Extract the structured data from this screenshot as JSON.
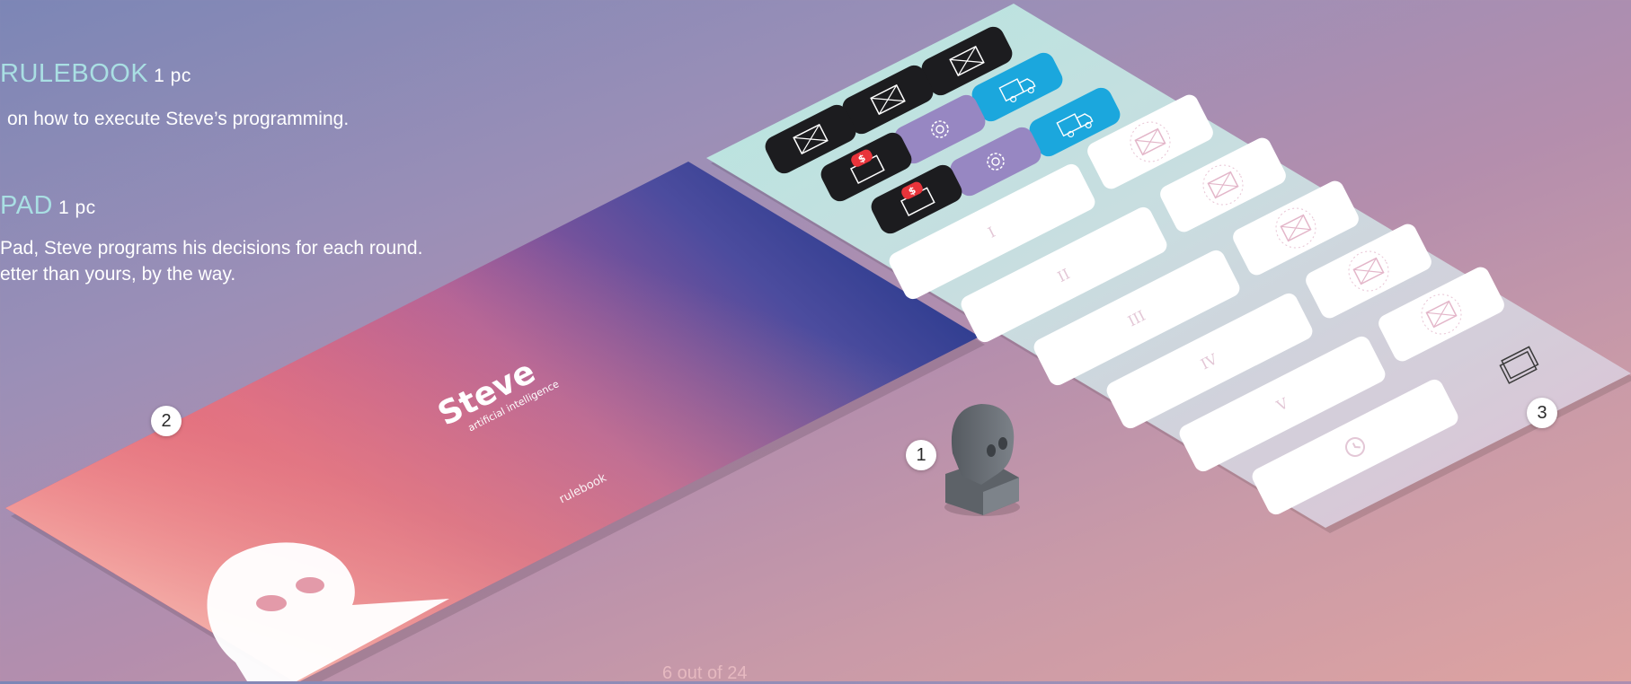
{
  "sections": [
    {
      "title": "RULEBOOK",
      "qty": "1 pc",
      "lines": [
        "on how to execute Steve’s programming."
      ]
    },
    {
      "title": "PAD",
      "qty": "1 pc",
      "lines": [
        "Pad, Steve programs his decisions for each round.",
        "etter than yours, by the way."
      ]
    }
  ],
  "rulebook": {
    "title": "Steve",
    "subtitle": "artificial intelligence",
    "label": "rulebook"
  },
  "pad": {
    "rounds": [
      "I",
      "II",
      "III",
      "IV",
      "V"
    ]
  },
  "callouts": [
    "1",
    "2",
    "3"
  ],
  "page": "6 out of 24",
  "colors": {
    "accent": "#a9dfe3",
    "purple_tile": "#9787c2",
    "blue_tile": "#1ba7dd",
    "black_tile": "#1c1c1f",
    "red_badge": "#e8343b"
  }
}
